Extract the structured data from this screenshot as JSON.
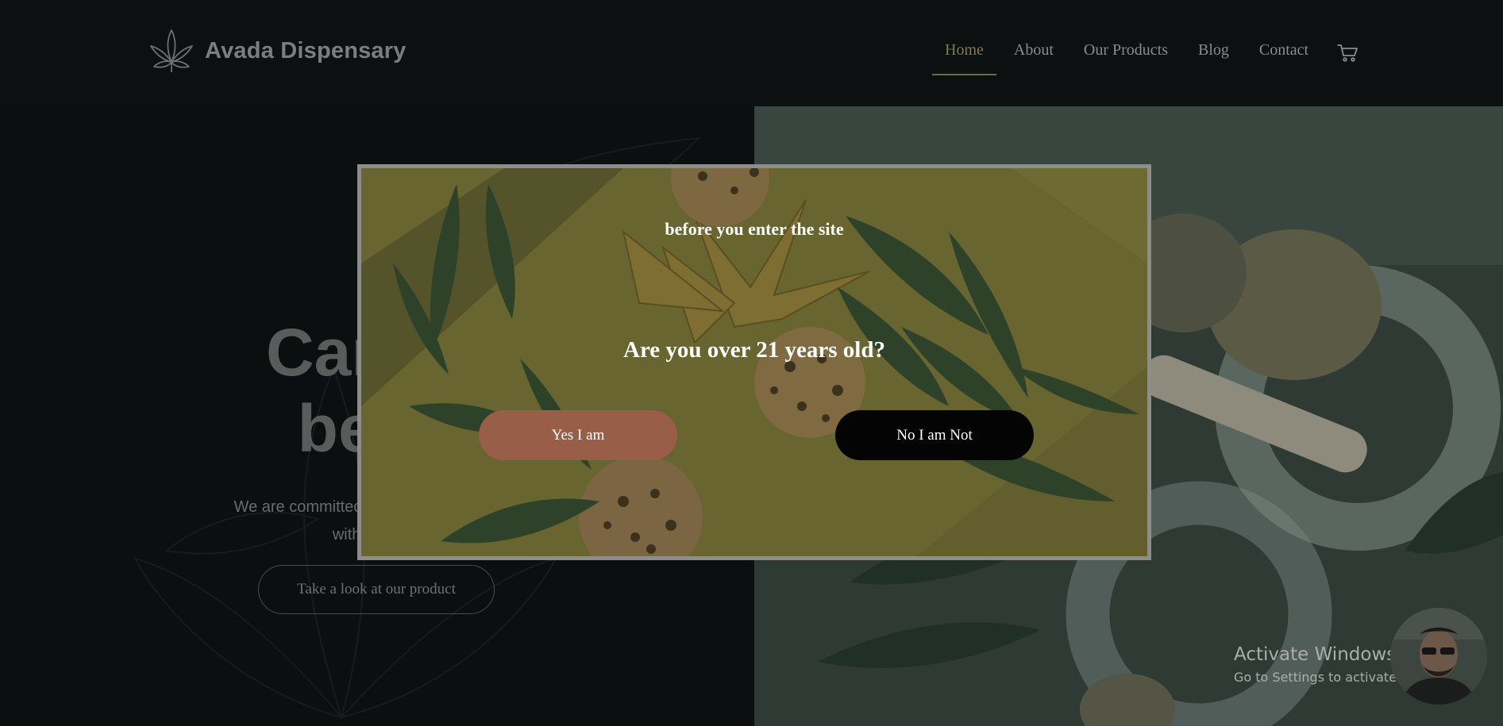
{
  "brand": {
    "name": "Avada Dispensary",
    "accent": "#7e7a52"
  },
  "nav": {
    "items": [
      {
        "label": "Home",
        "active": true
      },
      {
        "label": "About"
      },
      {
        "label": "Our Products"
      },
      {
        "label": "Blog"
      },
      {
        "label": "Contact"
      }
    ],
    "cart_icon": "cart-icon"
  },
  "hero": {
    "title_line1": "Cannal",
    "title_line2": "bette",
    "text_line1": "We are committed to staying at the forefr",
    "text_line2": "with the best",
    "button_label": "Take a look at our product"
  },
  "age_gate": {
    "subtitle": "before you enter the site",
    "question": "Are you over 21 years old?",
    "yes_label": "Yes I am",
    "no_label": "No I am Not",
    "yes_color": "#985e47",
    "no_color": "#040404"
  },
  "windows_notice": {
    "title": "Activate Windows",
    "subtitle": "Go to Settings to activate Windows."
  }
}
